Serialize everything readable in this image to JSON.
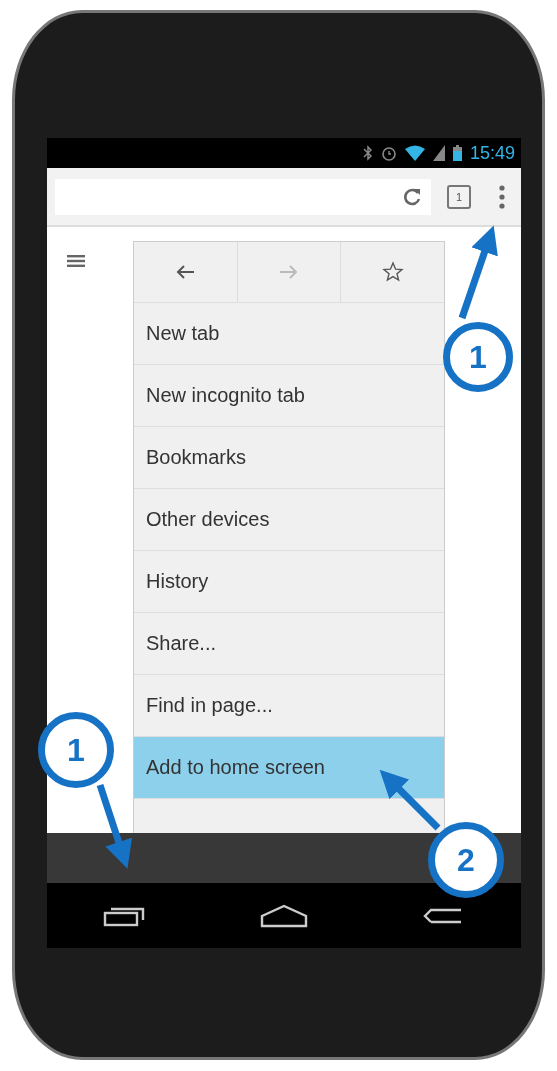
{
  "status_bar": {
    "time": "15:49"
  },
  "toolbar": {
    "tab_count": "1"
  },
  "menu": {
    "nav_icons": [
      {
        "kind": "back",
        "disabled": false
      },
      {
        "kind": "forward",
        "disabled": true
      },
      {
        "kind": "star",
        "disabled": false
      }
    ],
    "items": [
      {
        "label": "New tab",
        "selected": false
      },
      {
        "label": "New incognito tab",
        "selected": false
      },
      {
        "label": "Bookmarks",
        "selected": false
      },
      {
        "label": "Other devices",
        "selected": false
      },
      {
        "label": "History",
        "selected": false
      },
      {
        "label": "Share...",
        "selected": false
      },
      {
        "label": "Find in page...",
        "selected": false
      },
      {
        "label": "Add to home screen",
        "selected": true
      }
    ]
  },
  "annotations": [
    {
      "label": "1"
    },
    {
      "label": "1"
    },
    {
      "label": "2"
    }
  ]
}
